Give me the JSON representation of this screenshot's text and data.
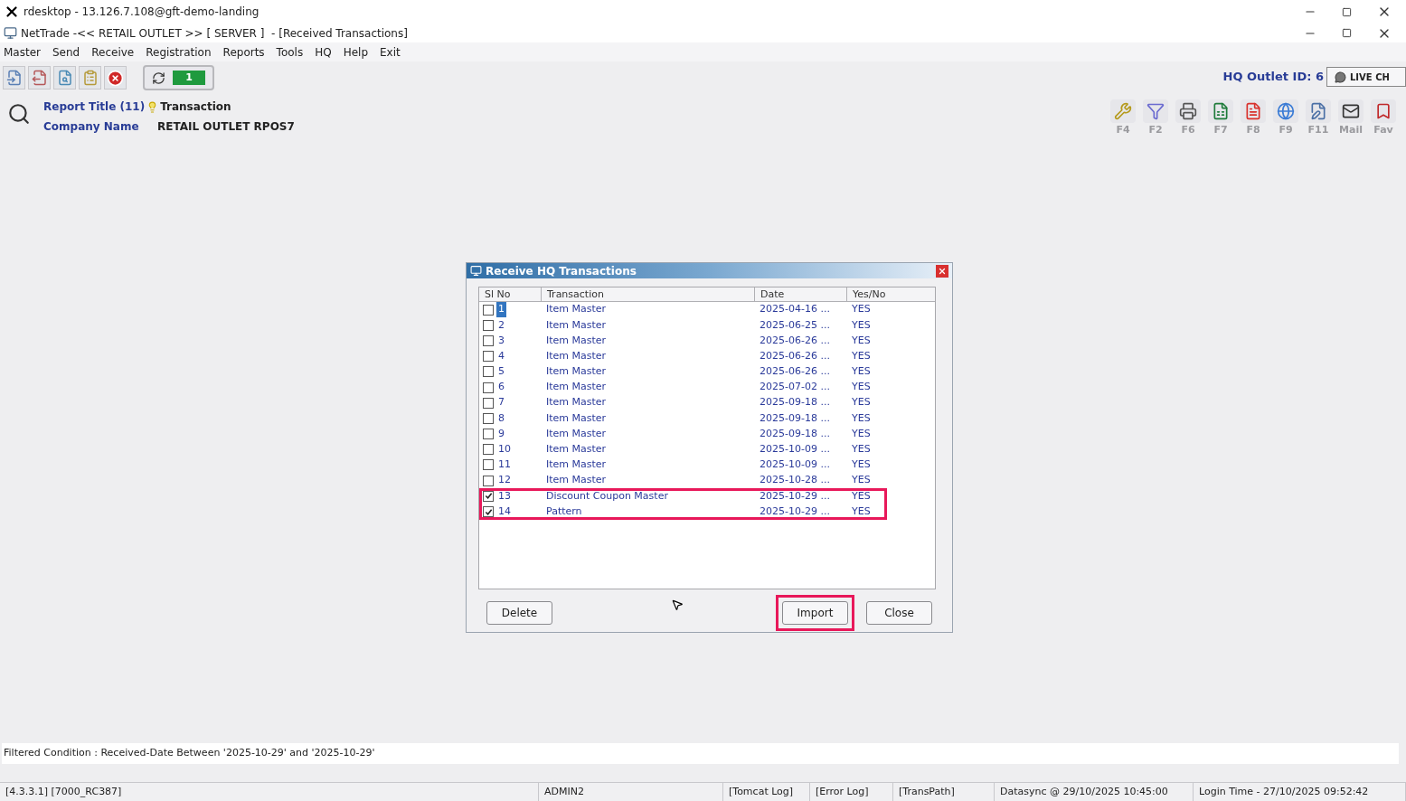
{
  "remote_window": {
    "title": "rdesktop - 13.126.7.108@gft-demo-landing"
  },
  "app_window": {
    "title": "NetTrade -<< RETAIL OUTLET >> [ SERVER ]  - [Received Transactions]"
  },
  "menu": [
    "Master",
    "Send",
    "Receive",
    "Registration",
    "Reports",
    "Tools",
    "HQ",
    "Help",
    "Exit"
  ],
  "toolbar": {
    "sync_count": "1"
  },
  "hq_outlet": {
    "label": "HQ Outlet ID: 6",
    "live_chat": "LIVE CH"
  },
  "report": {
    "title_label": "Report Title (11)",
    "title_value": "Transaction",
    "company_label": "Company Name",
    "company_value": "RETAIL OUTLET RPOS7"
  },
  "function_keys": [
    {
      "kind": "tools",
      "label": "F4"
    },
    {
      "kind": "filter",
      "label": "F2"
    },
    {
      "kind": "print",
      "label": "F6"
    },
    {
      "kind": "excel",
      "label": "F7"
    },
    {
      "kind": "pdf",
      "label": "F8"
    },
    {
      "kind": "web",
      "label": "F9"
    },
    {
      "kind": "edit",
      "label": "F11"
    },
    {
      "kind": "mail",
      "label": "Mail"
    },
    {
      "kind": "fav",
      "label": "Fav"
    }
  ],
  "dialog": {
    "title": "Receive HQ Transactions",
    "columns": [
      "Sl No",
      "Transaction",
      "Date",
      "Yes/No"
    ],
    "rows": [
      {
        "sl": "1",
        "transaction": "Item Master",
        "date": "2025-04-16 ...",
        "yes_no": "YES",
        "checked": false,
        "selected": true,
        "highlighted": false
      },
      {
        "sl": "2",
        "transaction": "Item Master",
        "date": "2025-06-25 ...",
        "yes_no": "YES",
        "checked": false,
        "selected": false,
        "highlighted": false
      },
      {
        "sl": "3",
        "transaction": "Item Master",
        "date": "2025-06-26 ...",
        "yes_no": "YES",
        "checked": false,
        "selected": false,
        "highlighted": false
      },
      {
        "sl": "4",
        "transaction": "Item Master",
        "date": "2025-06-26 ...",
        "yes_no": "YES",
        "checked": false,
        "selected": false,
        "highlighted": false
      },
      {
        "sl": "5",
        "transaction": "Item Master",
        "date": "2025-06-26 ...",
        "yes_no": "YES",
        "checked": false,
        "selected": false,
        "highlighted": false
      },
      {
        "sl": "6",
        "transaction": "Item Master",
        "date": "2025-07-02 ...",
        "yes_no": "YES",
        "checked": false,
        "selected": false,
        "highlighted": false
      },
      {
        "sl": "7",
        "transaction": "Item Master",
        "date": "2025-09-18 ...",
        "yes_no": "YES",
        "checked": false,
        "selected": false,
        "highlighted": false
      },
      {
        "sl": "8",
        "transaction": "Item Master",
        "date": "2025-09-18 ...",
        "yes_no": "YES",
        "checked": false,
        "selected": false,
        "highlighted": false
      },
      {
        "sl": "9",
        "transaction": "Item Master",
        "date": "2025-09-18 ...",
        "yes_no": "YES",
        "checked": false,
        "selected": false,
        "highlighted": false
      },
      {
        "sl": "10",
        "transaction": "Item Master",
        "date": "2025-10-09 ...",
        "yes_no": "YES",
        "checked": false,
        "selected": false,
        "highlighted": false
      },
      {
        "sl": "11",
        "transaction": "Item Master",
        "date": "2025-10-09 ...",
        "yes_no": "YES",
        "checked": false,
        "selected": false,
        "highlighted": false
      },
      {
        "sl": "12",
        "transaction": "Item Master",
        "date": "2025-10-28 ...",
        "yes_no": "YES",
        "checked": false,
        "selected": false,
        "highlighted": false
      },
      {
        "sl": "13",
        "transaction": "Discount Coupon Master",
        "date": "2025-10-29 ...",
        "yes_no": "YES",
        "checked": true,
        "selected": false,
        "highlighted": true
      },
      {
        "sl": "14",
        "transaction": "Pattern",
        "date": "2025-10-29 ...",
        "yes_no": "YES",
        "checked": true,
        "selected": false,
        "highlighted": true
      }
    ],
    "buttons": [
      {
        "label": "Delete",
        "highlighted": false
      },
      {
        "label": "Import",
        "highlighted": true
      },
      {
        "label": "Close",
        "highlighted": false
      }
    ]
  },
  "filter": "Filtered Condition : Received-Date Between '2025-10-29' and '2025-10-29'",
  "status_bar": [
    "[4.3.3.1] [7000_RC387]",
    "ADMIN2",
    "[Tomcat Log]",
    "[Error Log]",
    "[TransPath]",
    "Datasync @ 29/10/2025 10:45:00",
    "Login Time - 27/10/2025 09:52:42"
  ]
}
